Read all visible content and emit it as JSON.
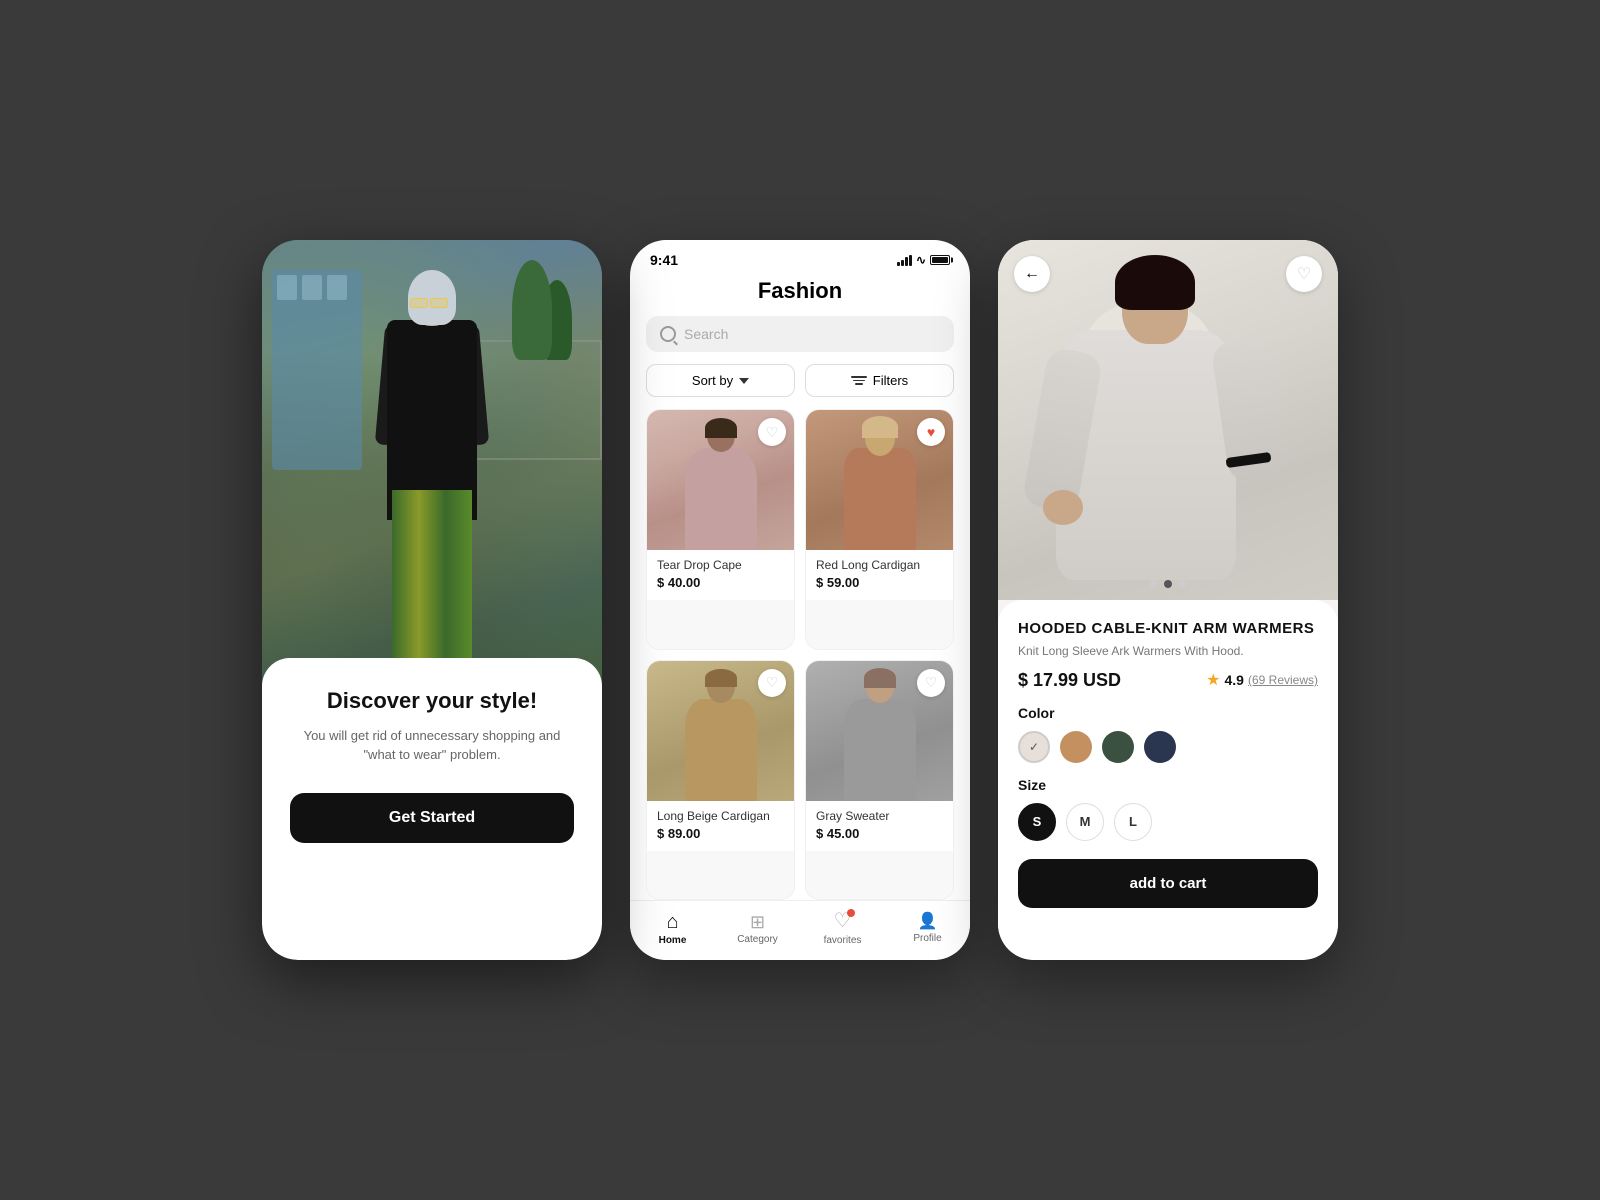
{
  "screen1": {
    "title": "Discover your style!",
    "subtitle": "You will get rid of unnecessary shopping and \"what to wear\" problem.",
    "cta": "Get Started"
  },
  "screen2": {
    "status": {
      "time": "9:41"
    },
    "header": "Fashion",
    "search": {
      "placeholder": "Search"
    },
    "sortLabel": "Sort by",
    "filtersLabel": "Filters",
    "products": [
      {
        "name": "Tear Drop Cape",
        "price": "$ 40.00",
        "liked": false,
        "colorClass": "sweater-pink"
      },
      {
        "name": "Red Long Cardigan",
        "price": "$ 59.00",
        "liked": true,
        "colorClass": "sweater-tan"
      },
      {
        "name": "Long Beige Cardigan",
        "price": "$ 89.00",
        "liked": false,
        "colorClass": "sweater-beige"
      },
      {
        "name": "Gray Sweater",
        "price": "$ 45.00",
        "liked": false,
        "colorClass": "sweater-gray"
      }
    ],
    "nav": [
      {
        "label": "Home",
        "icon": "⌂",
        "active": true
      },
      {
        "label": "Category",
        "icon": "⊞",
        "active": false
      },
      {
        "label": "favorites",
        "icon": "♡",
        "active": false,
        "badge": true
      },
      {
        "label": "Profile",
        "icon": "👤",
        "active": false
      }
    ]
  },
  "screen3": {
    "product": {
      "name": "HOODED CABLE-KNIT ARM WARMERS",
      "description": "Knit Long Sleeve Ark Warmers With Hood.",
      "price": "$ 17.99 USD",
      "rating": "4.9",
      "reviews": "(69 Reviews)",
      "colorLabel": "Color",
      "sizeLabel": "Size",
      "colors": [
        {
          "hex": "#e8e0d8",
          "selected": true
        },
        {
          "hex": "#c49060",
          "selected": false
        },
        {
          "hex": "#3a5040",
          "selected": false
        },
        {
          "hex": "#2a3550",
          "selected": false
        }
      ],
      "sizes": [
        {
          "label": "S",
          "active": true
        },
        {
          "label": "M",
          "active": false
        },
        {
          "label": "L",
          "active": false
        }
      ],
      "addToCart": "add to cart",
      "dots": [
        false,
        true,
        false
      ]
    }
  }
}
